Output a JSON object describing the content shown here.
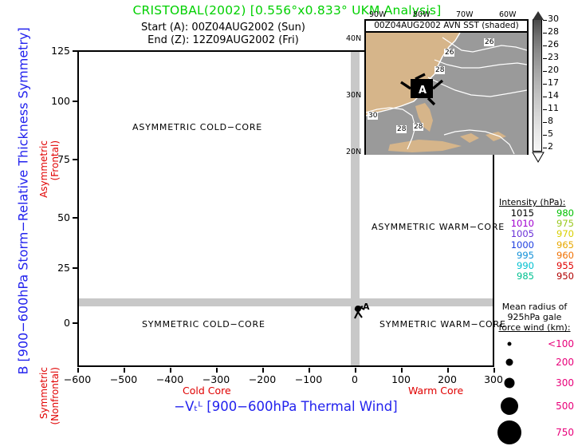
{
  "title": "CRISTOBAL(2002) [0.556°x0.833° UKM Analysis]",
  "subtitle_start": "Start (A): 00Z04AUG2002 (Sun)",
  "subtitle_end": "End (Z): 12Z09AUG2002 (Fri)",
  "axes": {
    "y_title": "B [900−600hPa Storm−Relative Thickness Symmetry]",
    "x_title": "−Vₜᴸ [900−600hPa Thermal Wind]",
    "y_ticks": [
      "125",
      "100",
      "75",
      "50",
      "25",
      "0"
    ],
    "x_ticks": [
      "−600",
      "−500",
      "−400",
      "−300",
      "−200",
      "−100",
      "0",
      "100",
      "200",
      "300"
    ],
    "y_top_annot_line1": "Asymmetric",
    "y_top_annot_line2": "(Frontal)",
    "y_bot_annot_line1": "Symmetric",
    "y_bot_annot_line2": "(Nonfrontal)",
    "x_left_annot": "Cold Core",
    "x_right_annot": "Warm Core",
    "annot_color": "#e00000",
    "title_color": "#2222ee"
  },
  "quadrants": {
    "asym_cold": "ASYMMETRIC COLD−CORE",
    "asym_warm": "ASYMMETRIC WARM−CORE",
    "sym_cold": "SYMMETRIC COLD−CORE",
    "sym_warm": "SYMMETRIC WARM−CORE"
  },
  "map": {
    "header": "00Z04AUG2002 AVN SST (shaded)",
    "lon_labels": [
      "90W",
      "80W",
      "70W",
      "60W"
    ],
    "lat_labels": [
      "40N",
      "30N",
      "20N"
    ],
    "contour_labels": [
      "26",
      "26",
      "28",
      "30",
      "28",
      "28"
    ],
    "storm_marker_label": "A"
  },
  "colorbar": {
    "units": "",
    "ticks": [
      "30",
      "28",
      "26",
      "23",
      "20",
      "17",
      "14",
      "11",
      "8",
      "5",
      "2"
    ]
  },
  "intensity_legend": {
    "header": "Intensity (hPa):",
    "rows": [
      {
        "left": "1015",
        "left_color": "#000000",
        "right": "980",
        "right_color": "#00c000"
      },
      {
        "left": "1010",
        "left_color": "#a000d0",
        "right": "975",
        "right_color": "#9ac81e"
      },
      {
        "left": "1005",
        "left_color": "#6a30d8",
        "right": "970",
        "right_color": "#d8d000"
      },
      {
        "left": "1000",
        "left_color": "#2040e0",
        "right": "965",
        "right_color": "#e8a800"
      },
      {
        "left": "995",
        "left_color": "#1090d8",
        "right": "960",
        "right_color": "#f07000"
      },
      {
        "left": "990",
        "left_color": "#00c0d0",
        "right": "955",
        "right_color": "#e00000"
      },
      {
        "left": "985",
        "left_color": "#00c090",
        "right": "950",
        "right_color": "#b00000"
      }
    ]
  },
  "radius_legend": {
    "line1": "Mean radius of",
    "line2": "925hPa gale",
    "line3": "force wind (km):",
    "value_color": "#e8007a",
    "rows": [
      {
        "label": "<100",
        "dot": 4
      },
      {
        "label": "200",
        "dot": 7
      },
      {
        "label": "300",
        "dot": 11
      },
      {
        "label": "500",
        "dot": 18
      },
      {
        "label": "750",
        "dot": 25
      }
    ]
  },
  "chart_data": {
    "type": "scatter",
    "title": "CRISTOBAL(2002) [0.556°x0.833° UKM Analysis]",
    "xlabel": "−V_T^L [900−600hPa Thermal Wind]",
    "ylabel": "B [900−600hPa Storm−Relative Thickness Symmetry]",
    "xlim": [
      -600,
      300
    ],
    "ylim": [
      -10,
      130
    ],
    "xticks": [
      -600,
      -500,
      -400,
      -300,
      -200,
      -100,
      0,
      100,
      200,
      300
    ],
    "yticks": [
      0,
      25,
      50,
      75,
      100,
      125
    ],
    "grid": false,
    "reference_lines": {
      "x": 0,
      "y": 10,
      "color": "#c8c8c8"
    },
    "points": [
      {
        "label": "A",
        "x": 5,
        "y": 5,
        "intensity_hPa": 1015,
        "radius_km": 100
      }
    ],
    "legend_position": "right"
  }
}
